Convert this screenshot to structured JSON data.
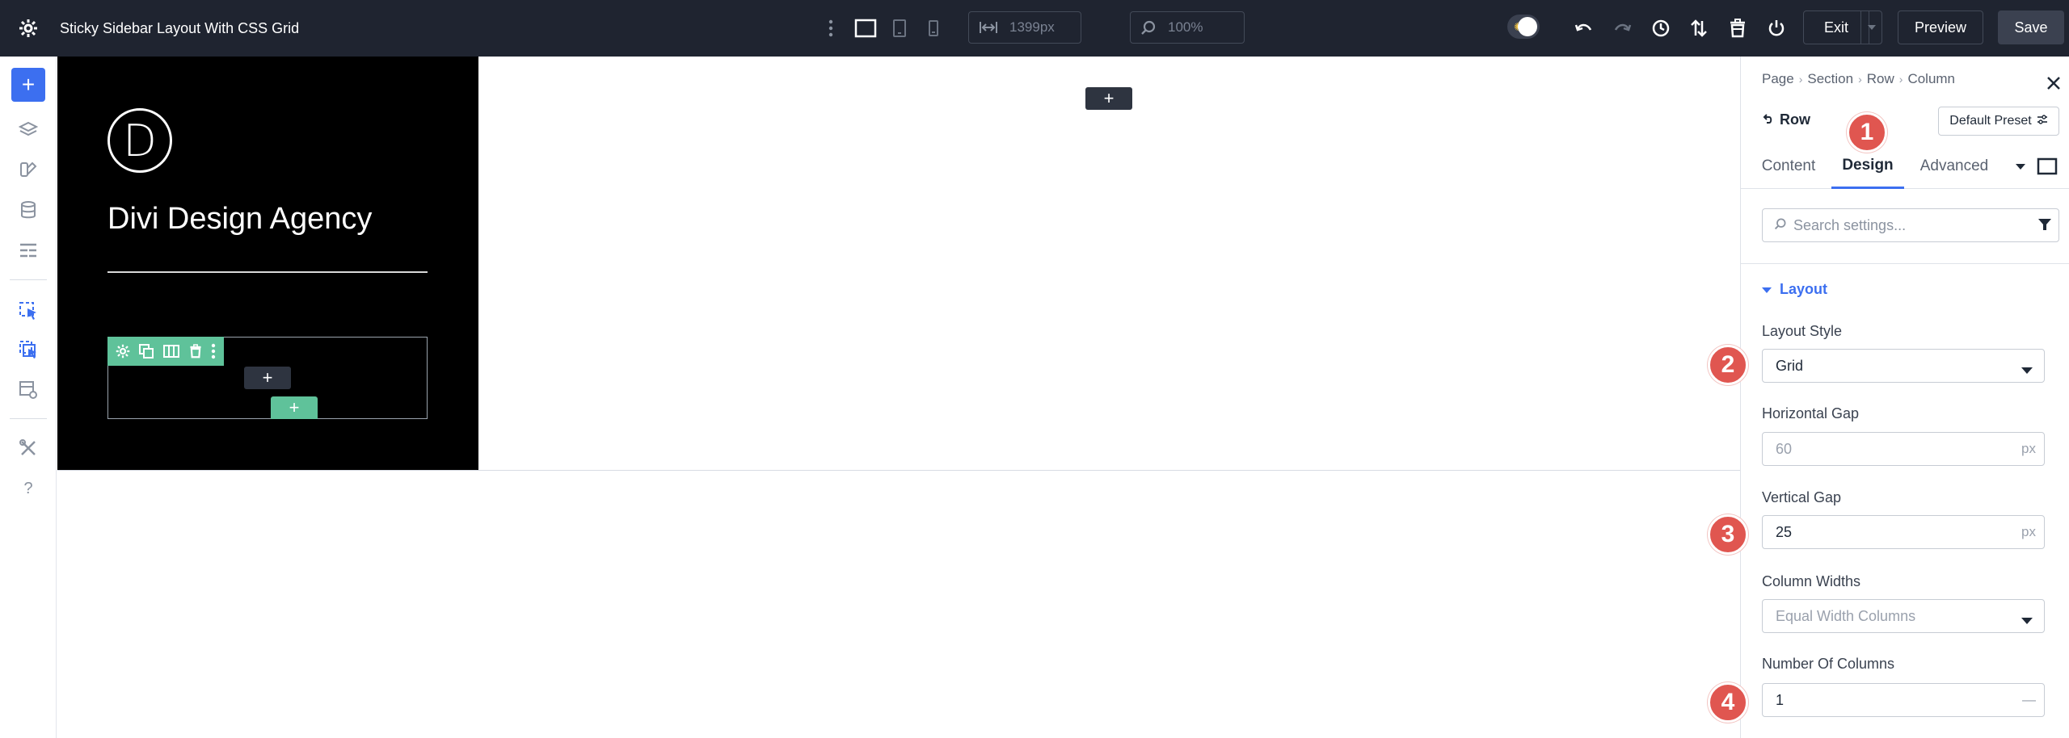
{
  "topbar": {
    "title": "Sticky Sidebar Layout With CSS Grid",
    "width_value": "1399px",
    "zoom_value": "100%",
    "exit_label": "Exit",
    "preview_label": "Preview",
    "save_label": "Save"
  },
  "canvas": {
    "logo_letter": "D",
    "agency_name": "Divi Design Agency",
    "add_symbol": "+"
  },
  "panel": {
    "breadcrumb": [
      "Page",
      "Section",
      "Row",
      "Column"
    ],
    "back_label": "Row",
    "preset_label": "Default Preset",
    "tabs": [
      "Content",
      "Design",
      "Advanced"
    ],
    "search_placeholder": "Search settings...",
    "group_title": "Layout",
    "fields": {
      "layout_style_label": "Layout Style",
      "layout_style_value": "Grid",
      "horizontal_gap_label": "Horizontal Gap",
      "horizontal_gap_value": "60",
      "vertical_gap_label": "Vertical Gap",
      "vertical_gap_value": "25",
      "column_widths_label": "Column Widths",
      "column_widths_value": "Equal Width Columns",
      "num_columns_label": "Number Of Columns",
      "num_columns_value": "1",
      "unit": "px",
      "stepper_symbol": "—"
    }
  },
  "callouts": [
    "1",
    "2",
    "3",
    "4"
  ],
  "colors": {
    "accent": "#3c6ff0",
    "topbar": "#1f2430",
    "row_green": "#5fc29a",
    "callout_red": "#e05650"
  }
}
